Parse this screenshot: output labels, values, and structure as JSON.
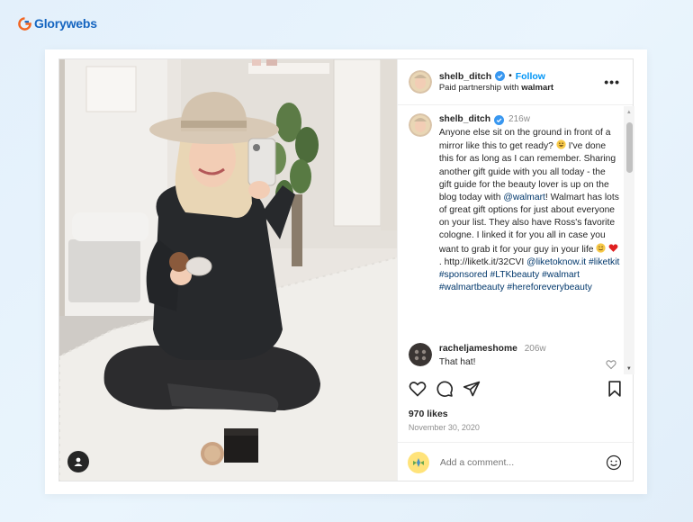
{
  "brand": {
    "name": "Glorywebs"
  },
  "post": {
    "header": {
      "username": "shelb_ditch",
      "follow_label": "Follow",
      "separator": "•",
      "paid_prefix": "Paid partnership with",
      "partner": "walmart",
      "more_label": "•••"
    },
    "caption": {
      "username": "shelb_ditch",
      "time": "216w",
      "text_1": "Anyone else sit on the ground in front of a mirror like this to get ready?",
      "text_2": "I've done this for as long as I can remember. Sharing another gift guide with you all today - the gift guide for the beauty lover is up on the blog today with",
      "mention_walmart": "@walmart",
      "text_3": "! Walmart has lots of great gift options for just about everyone on your list. They also have Ross's favorite cologne. I linked it for you all in case you want to grab it for your guy in your life",
      "url": "http://liketk.it/32CVI",
      "mention_liketoknow": "@liketoknow.it",
      "tags": [
        "#liketkit",
        "#sponsored",
        "#LTKbeauty",
        "#walmart",
        "#walmartbeauty",
        "#hereforeverybeauty"
      ]
    },
    "comment": {
      "username": "racheljameshome",
      "time": "206w",
      "text": "That hat!"
    },
    "likes": "970 likes",
    "date": "November 30, 2020",
    "add_comment_placeholder": "Add a comment..."
  },
  "icons": {
    "like": "heart-icon",
    "comment": "comment-icon",
    "share": "paper-plane-icon",
    "save": "bookmark-icon",
    "emoji": "smiley-icon",
    "verified": "verified-badge-icon",
    "tag": "user-tag-icon"
  },
  "colors": {
    "brand_blue": "#1565c0",
    "brand_orange": "#f26522",
    "link": "#00376b",
    "follow": "#0095f6",
    "heart": "#e02020"
  }
}
